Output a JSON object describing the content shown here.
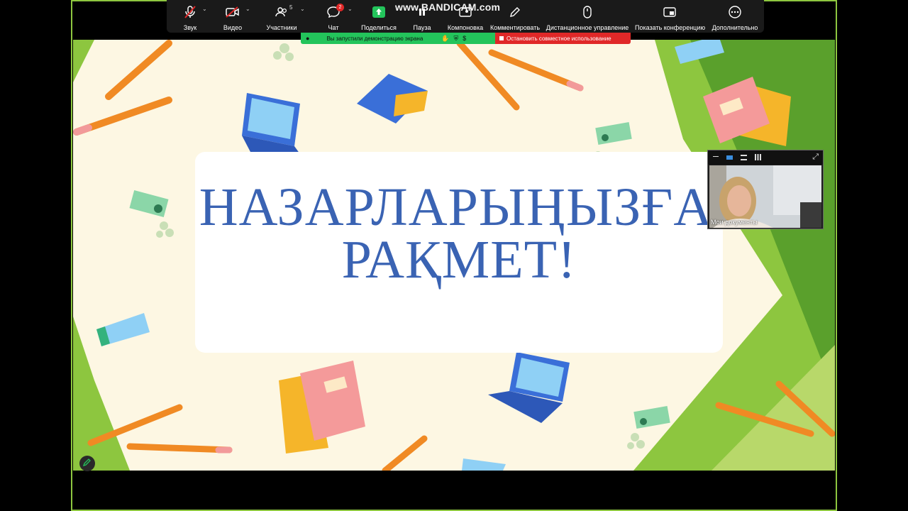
{
  "toolbar": {
    "items": [
      {
        "label": "Звук",
        "icon": "microphone-muted-icon"
      },
      {
        "label": "Видео",
        "icon": "camera-off-icon"
      },
      {
        "label": "Участники",
        "icon": "participants-icon",
        "count": "5"
      },
      {
        "label": "Чат",
        "icon": "chat-icon",
        "badge": "2"
      },
      {
        "label": "Поделиться",
        "icon": "share-screen-icon"
      },
      {
        "label": "Пауза",
        "icon": "pause-icon"
      },
      {
        "label": "Компоновка",
        "icon": "layout-icon"
      },
      {
        "label": "Комментировать",
        "icon": "annotate-icon"
      },
      {
        "label": "Дистанционное управление",
        "icon": "remote-control-icon"
      },
      {
        "label": "Показать конференцию",
        "icon": "show-meeting-icon"
      },
      {
        "label": "Дополнительно",
        "icon": "more-icon"
      }
    ]
  },
  "watermark": "www.BANDICAM.com",
  "share_banner": {
    "text": "Вы запустили демонстрацию экрана",
    "stop_label": "Остановить совместное использование"
  },
  "slide": {
    "title_line1": "НАЗАРЛАРЫҢЫЗҒА",
    "title_line2": "РАҚМЕТ!"
  },
  "video": {
    "name": "Мои документы"
  },
  "colors": {
    "toolbar_bg": "#1a1a1a",
    "share_green": "#23c45b",
    "stop_red": "#e02828",
    "title_blue": "#3a63b3",
    "slide_bg": "#fdf7e3",
    "frame_green": "#8dc63f"
  }
}
